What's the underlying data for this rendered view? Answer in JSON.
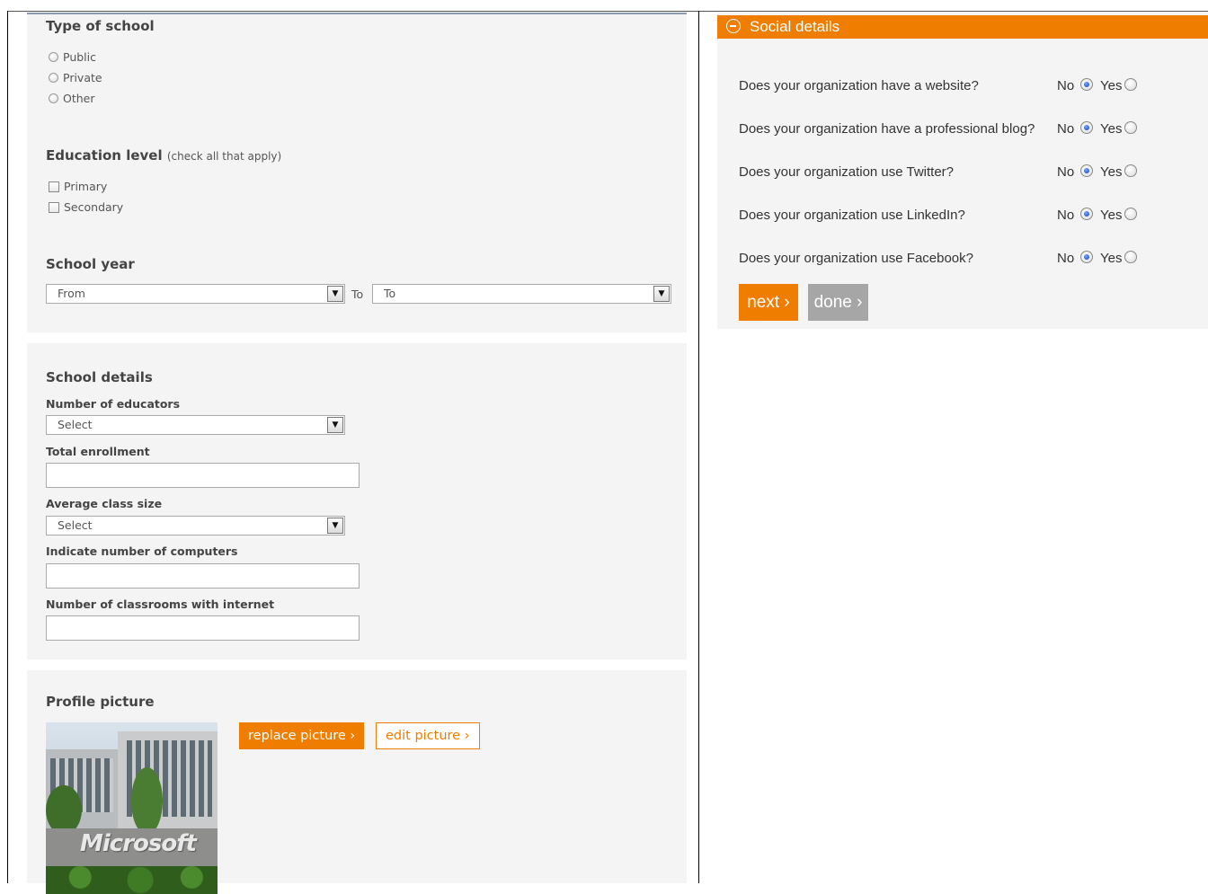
{
  "type_of_school": {
    "heading": "Type of school",
    "options": [
      "Public",
      "Private",
      "Other"
    ]
  },
  "education_level": {
    "heading": "Education level",
    "note": "(check all that apply)",
    "options": [
      "Primary",
      "Secondary"
    ]
  },
  "school_year": {
    "heading": "School year",
    "from_value": "From",
    "to_label": "To",
    "to_value": "To"
  },
  "school_details": {
    "heading": "School details",
    "educators_label": "Number of educators",
    "educators_value": "Select",
    "enrollment_label": "Total enrollment",
    "class_size_label": "Average class size",
    "class_size_value": "Select",
    "computers_label": "Indicate number of computers",
    "classrooms_label": "Number of classrooms with internet"
  },
  "profile_picture": {
    "heading": "Profile picture",
    "image_text": "Microsoft",
    "replace_label": "replace picture ›",
    "edit_label": "edit picture ›"
  },
  "social": {
    "header": "Social details",
    "no_label": "No",
    "yes_label": "Yes",
    "questions": [
      "Does your organization have a website?",
      "Does your organization have a professional blog?",
      "Does your organization use Twitter?",
      "Does your organization use LinkedIn?",
      "Does your organization use Facebook?"
    ],
    "next_label": "next ›",
    "done_label": "done ›"
  },
  "colors": {
    "accent": "#ef7d00",
    "panel_bg": "#f4f4f4",
    "done_button": "#a6a6a6",
    "radio_selected": "#1244b3"
  }
}
